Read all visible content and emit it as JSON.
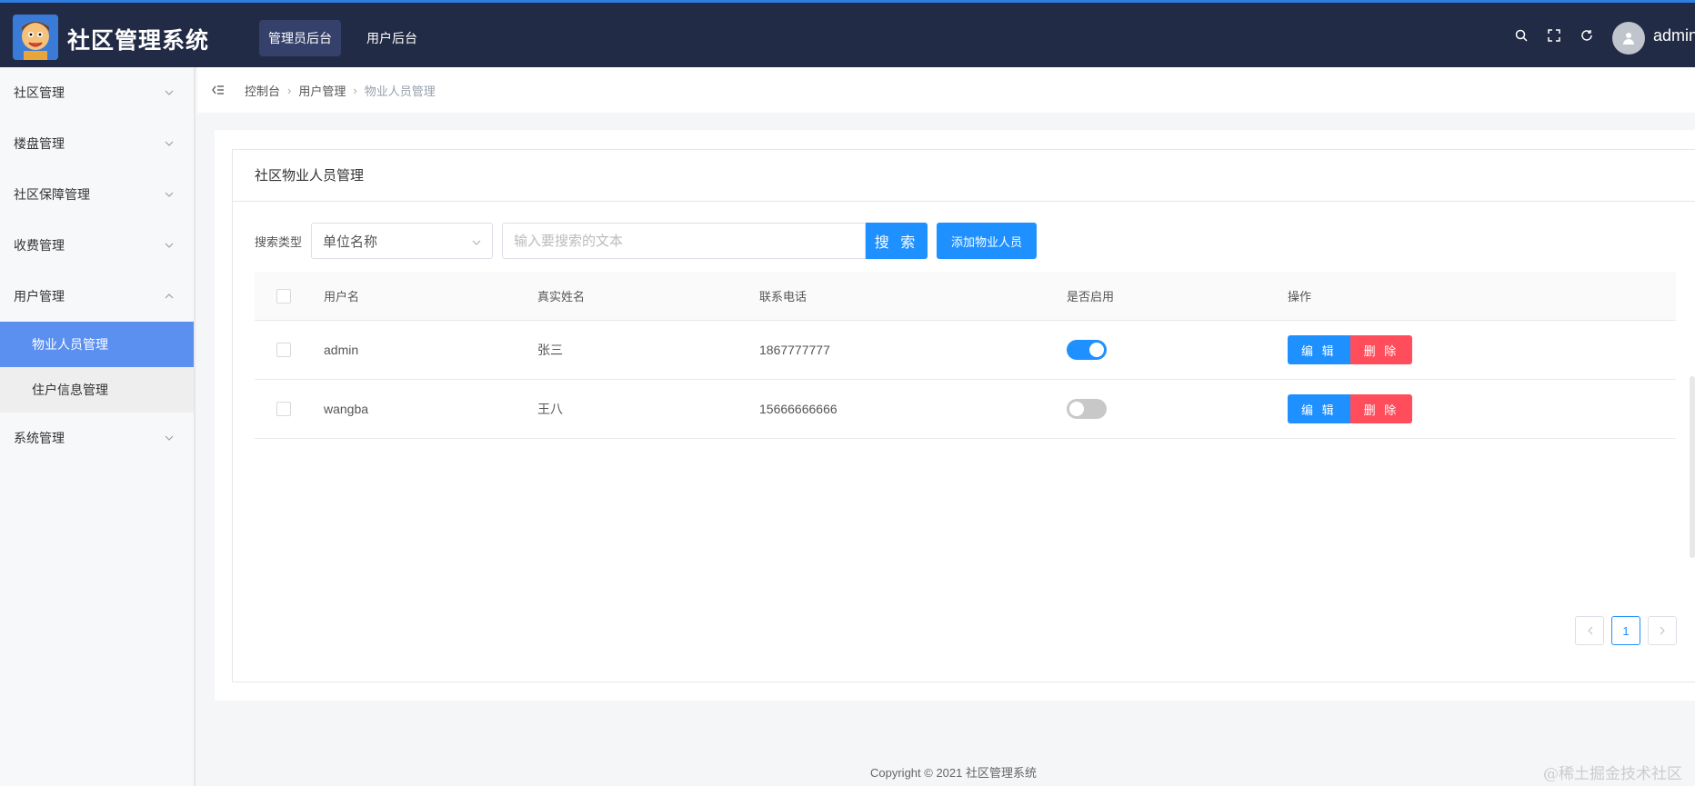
{
  "header": {
    "brand": "社区管理系统",
    "nav": [
      {
        "label": "管理员后台",
        "active": true
      },
      {
        "label": "用户后台",
        "active": false
      }
    ],
    "user": "admin",
    "tools": [
      "search-icon",
      "fullscreen-icon",
      "refresh-icon"
    ]
  },
  "sidebar": {
    "menus": [
      {
        "label": "社区管理",
        "expanded": false
      },
      {
        "label": "楼盘管理",
        "expanded": false
      },
      {
        "label": "社区保障管理",
        "expanded": false
      },
      {
        "label": "收费管理",
        "expanded": false
      },
      {
        "label": "用户管理",
        "expanded": true
      },
      {
        "label": "系统管理",
        "expanded": false
      }
    ],
    "submenu": [
      {
        "label": "物业人员管理",
        "active": true
      },
      {
        "label": "住户信息管理",
        "active": false
      }
    ]
  },
  "breadcrumb": [
    "控制台",
    "用户管理",
    "物业人员管理"
  ],
  "panel": {
    "title": "社区物业人员管理",
    "search_label": "搜索类型",
    "search_type": "单位名称",
    "search_placeholder": "输入要搜索的文本",
    "search_button": "搜 索",
    "add_button": "添加物业人员"
  },
  "table": {
    "headers": [
      "用户名",
      "真实姓名",
      "联系电话",
      "是否启用",
      "操作"
    ],
    "rows": [
      {
        "username": "admin",
        "realname": "张三",
        "phone": "1867777777",
        "enabled": true
      },
      {
        "username": "wangba",
        "realname": "王八",
        "phone": "15666666666",
        "enabled": false
      }
    ],
    "edit_label": "编 辑",
    "delete_label": "删 除"
  },
  "pagination": {
    "current": "1"
  },
  "footer": "Copyright © 2021 社区管理系统",
  "watermark": "@稀土掘金技术社区",
  "colors": {
    "primary": "#1e90ff",
    "danger": "#ff4d5b",
    "header": "#222b45",
    "active_menu": "#5b8ff0"
  }
}
